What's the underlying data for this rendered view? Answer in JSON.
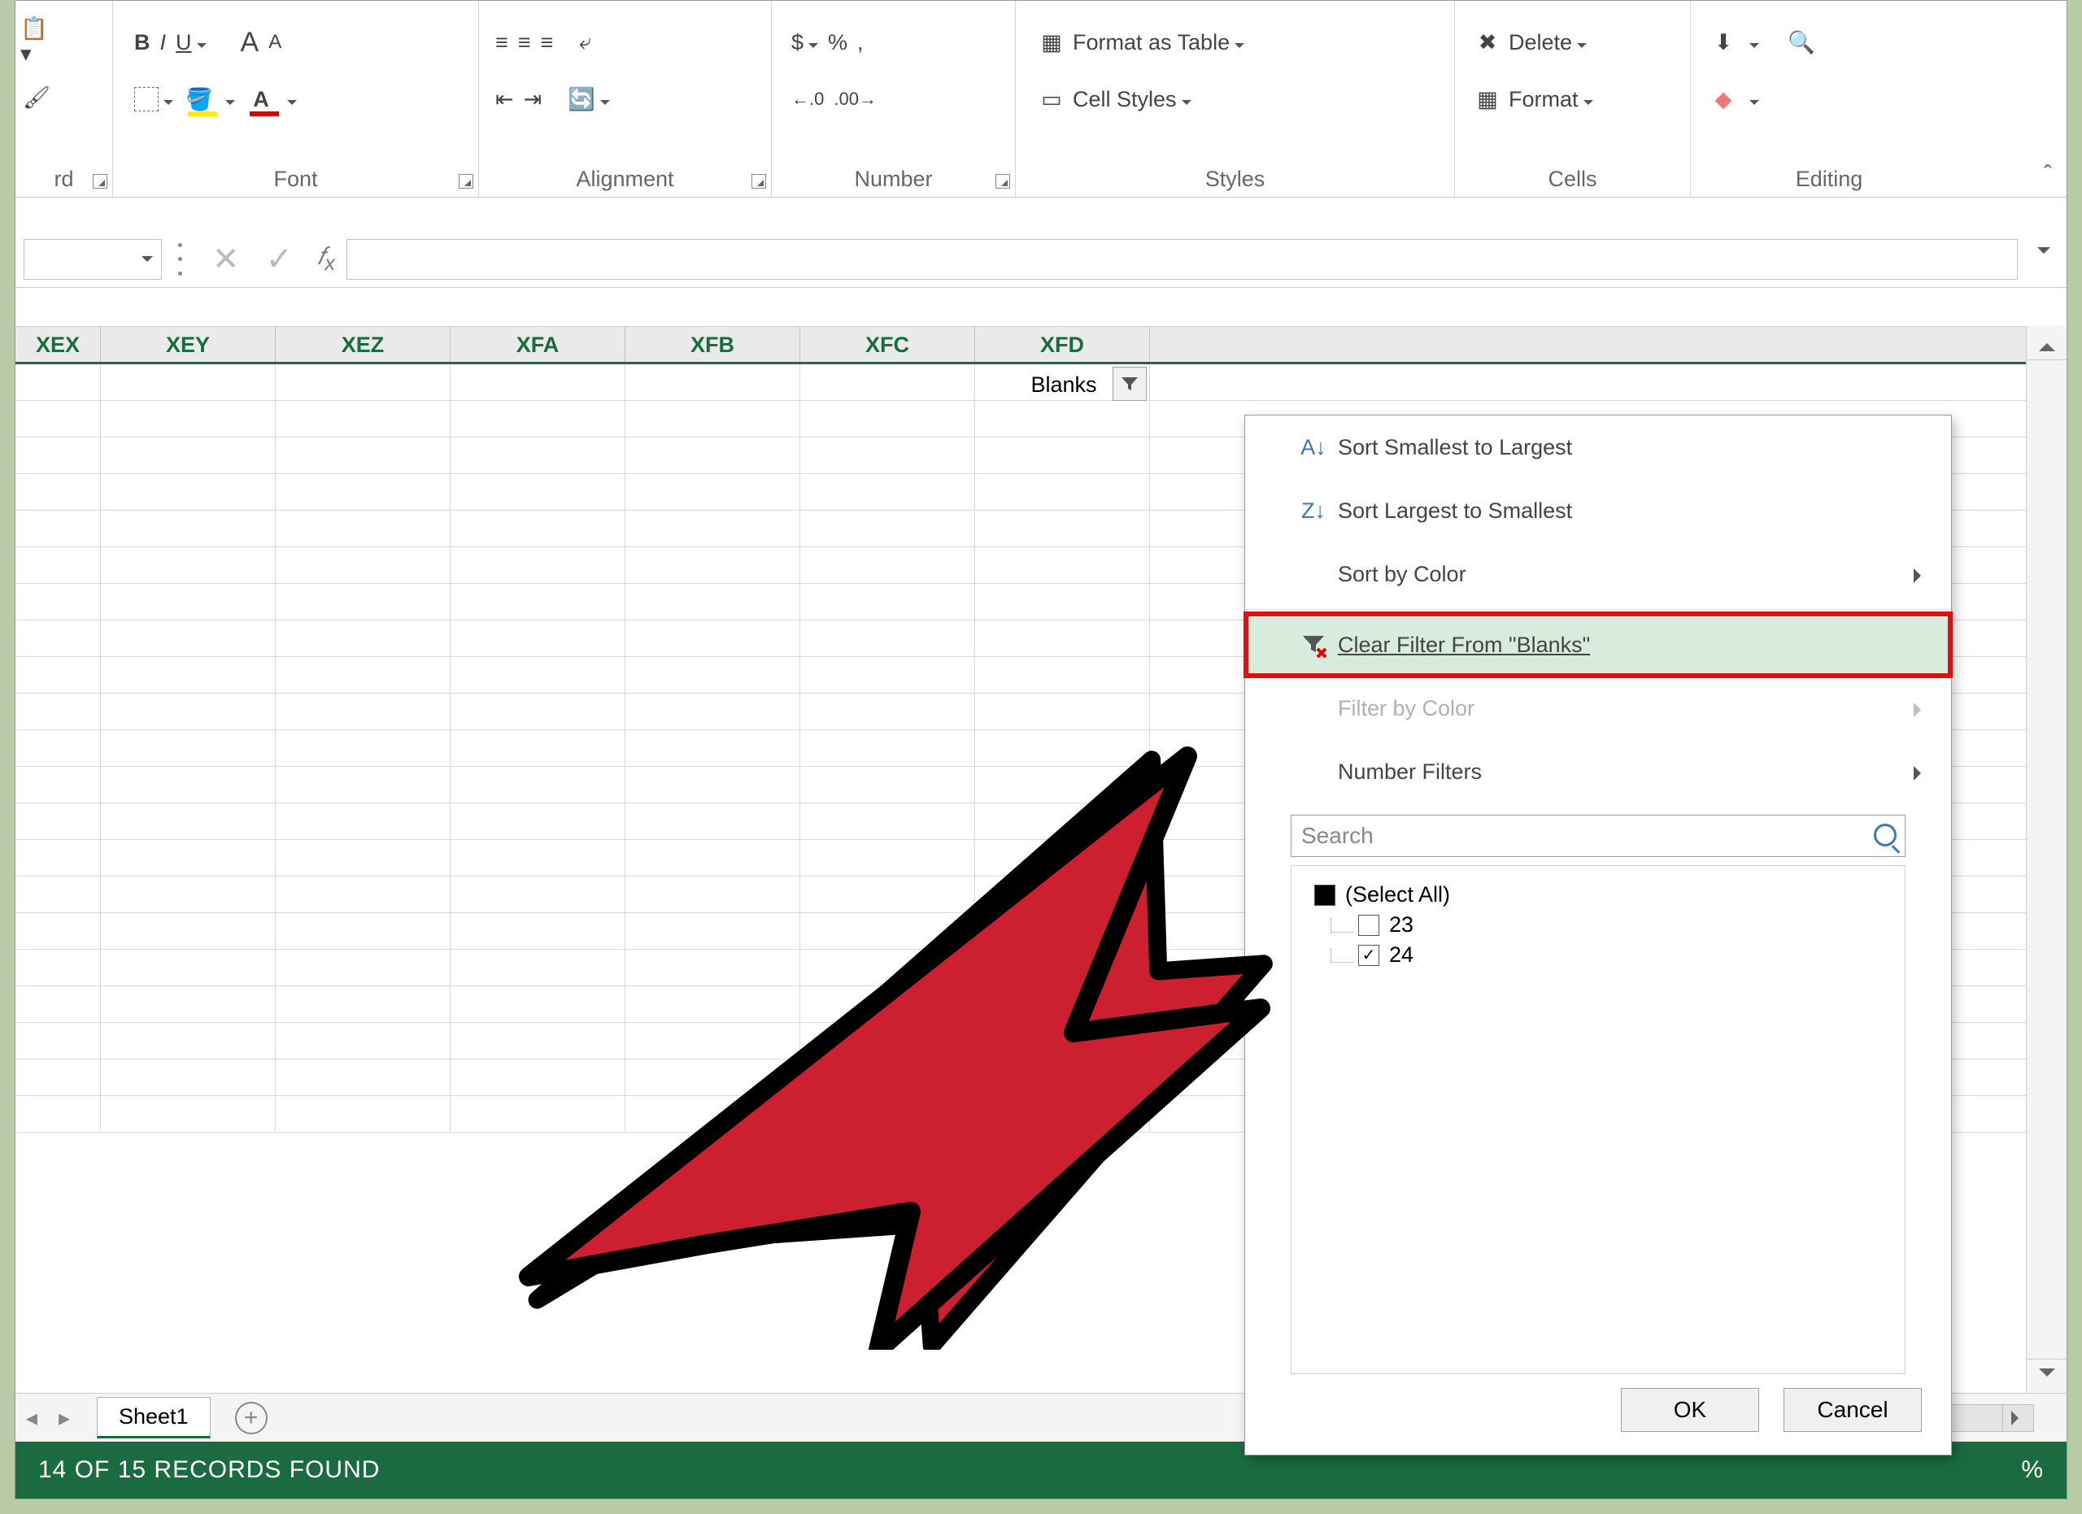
{
  "ribbon": {
    "clipboard": {
      "label": "rd"
    },
    "font": {
      "label": "Font",
      "bold": "B",
      "italic": "I",
      "underline": "U",
      "growA": "A",
      "shrinkA": "A"
    },
    "alignment": {
      "label": "Alignment"
    },
    "number": {
      "label": "Number",
      "currency": "$",
      "percent": "%",
      "inc": ".0 .00",
      "dec": ".00 .0"
    },
    "styles": {
      "label": "Styles",
      "formatTable": "Format as Table",
      "cellStyles": "Cell Styles"
    },
    "cells": {
      "label": "Cells",
      "delete": "Delete",
      "format": "Format"
    },
    "editing": {
      "label": "Editing"
    }
  },
  "columns": [
    "XEX",
    "XEY",
    "XEZ",
    "XFA",
    "XFB",
    "XFC",
    "XFD"
  ],
  "filter_column_label": "Blanks",
  "tabs": {
    "sheet": "Sheet1"
  },
  "status": {
    "text": "14 OF 15 RECORDS FOUND",
    "zoom": "%"
  },
  "popup": {
    "sort_asc": "Sort Smallest to Largest",
    "sort_desc": "Sort Largest to Smallest",
    "sort_color": "Sort by Color",
    "clear_filter": "Clear Filter From \"Blanks\"",
    "filter_color": "Filter by Color",
    "number_filters": "Number Filters",
    "search_placeholder": "Search",
    "select_all": "(Select All)",
    "opt1": "23",
    "opt2": "24",
    "ok": "OK",
    "cancel": "Cancel"
  }
}
